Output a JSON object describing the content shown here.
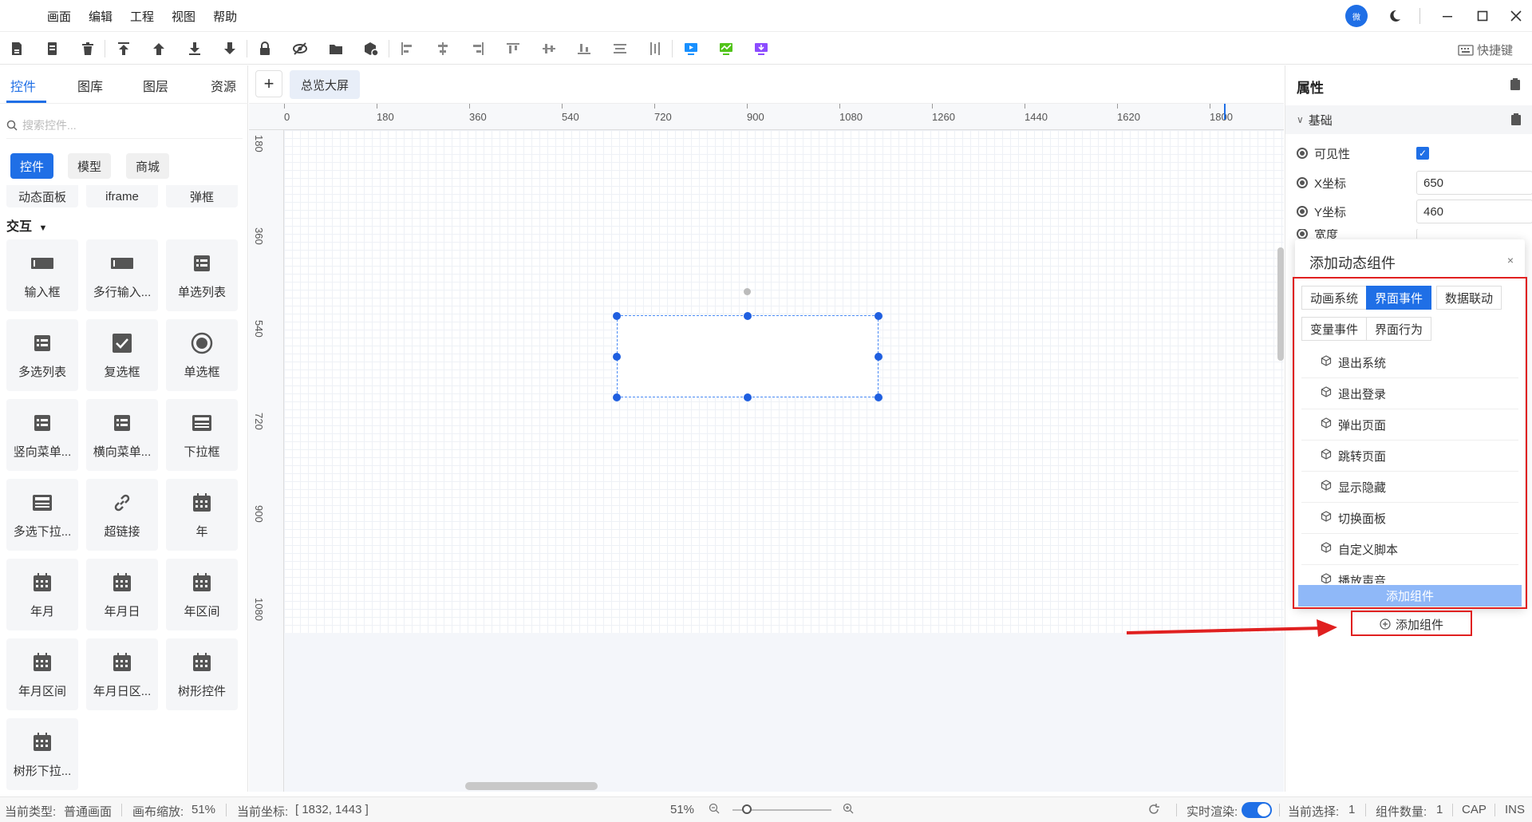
{
  "menubar": {
    "menus": [
      "画面",
      "编辑",
      "工程",
      "视图",
      "帮助"
    ],
    "avatar_text": "微"
  },
  "toolbar": {
    "shortcut_label": "快捷键",
    "icons": [
      "save-icon",
      "save-as-icon",
      "delete-icon",
      "bring-to-front-icon",
      "bring-forward-icon",
      "send-backward-icon",
      "send-to-back-icon",
      "lock-icon",
      "hide-icon",
      "open-folder-icon",
      "component-settings-icon",
      "align-left-icon",
      "align-center-h-icon",
      "align-right-icon",
      "align-top-icon",
      "align-middle-icon",
      "align-bottom-icon",
      "distribute-h-icon",
      "distribute-v-icon",
      "preview-icon",
      "chart-icon",
      "publish-icon"
    ],
    "accent": "#1f6fe6",
    "preview_color": "#1890ff",
    "chart_color": "#52c41a",
    "publish_color": "#8c4bff"
  },
  "left": {
    "tabs": [
      "控件",
      "图库",
      "图层",
      "资源"
    ],
    "search_placeholder": "搜索控件...",
    "pills": [
      "控件",
      "模型",
      "商城"
    ],
    "cut_row": [
      "动态面板",
      "iframe",
      "弹框"
    ],
    "section_title": "交互",
    "components": [
      "输入框",
      "多行输入...",
      "单选列表",
      "多选列表",
      "复选框",
      "单选框",
      "竖向菜单...",
      "横向菜单...",
      "下拉框",
      "多选下拉...",
      "超链接",
      "年",
      "年月",
      "年月日",
      "年区间",
      "年月区间",
      "年月日区...",
      "树形控件",
      "树形下拉..."
    ]
  },
  "center": {
    "page_tab": "总览大屏",
    "ruler_top": [
      "0",
      "180",
      "360",
      "540",
      "720",
      "900",
      "1080",
      "1260",
      "1440",
      "1620",
      "1800"
    ],
    "ruler_left": [
      "180",
      "360",
      "540",
      "720",
      "900",
      "1080"
    ]
  },
  "right": {
    "title": "属性",
    "group": "基础",
    "visible_label": "可见性",
    "x_label": "X坐标",
    "x_value": "650",
    "y_label": "Y坐标",
    "y_value": "460",
    "partial_label": "宽度"
  },
  "popup": {
    "title": "添加动态组件",
    "close": "×",
    "tabs_row1": [
      "动画系统",
      "界面事件",
      "数据联动"
    ],
    "tabs_row2": [
      "变量事件",
      "界面行为"
    ],
    "active_tab": "界面事件",
    "events": [
      "退出系统",
      "退出登录",
      "弹出页面",
      "跳转页面",
      "显示隐藏",
      "切换面板",
      "自定义脚本",
      "播放声音"
    ],
    "add_button": "添加组件"
  },
  "add_component": "添加组件",
  "status": {
    "type_label": "当前类型:",
    "type_value": "普通画面",
    "zoom_label": "画布缩放:",
    "zoom_value": "51%",
    "coord_label": "当前坐标:",
    "coord_value": "[ 1832, 1443 ]",
    "zoom_percent": "51%",
    "realtime_label": "实时渲染:",
    "selected_label": "当前选择:",
    "selected_value": "1",
    "count_label": "组件数量:",
    "count_value": "1",
    "cap": "CAP",
    "ins": "INS"
  }
}
